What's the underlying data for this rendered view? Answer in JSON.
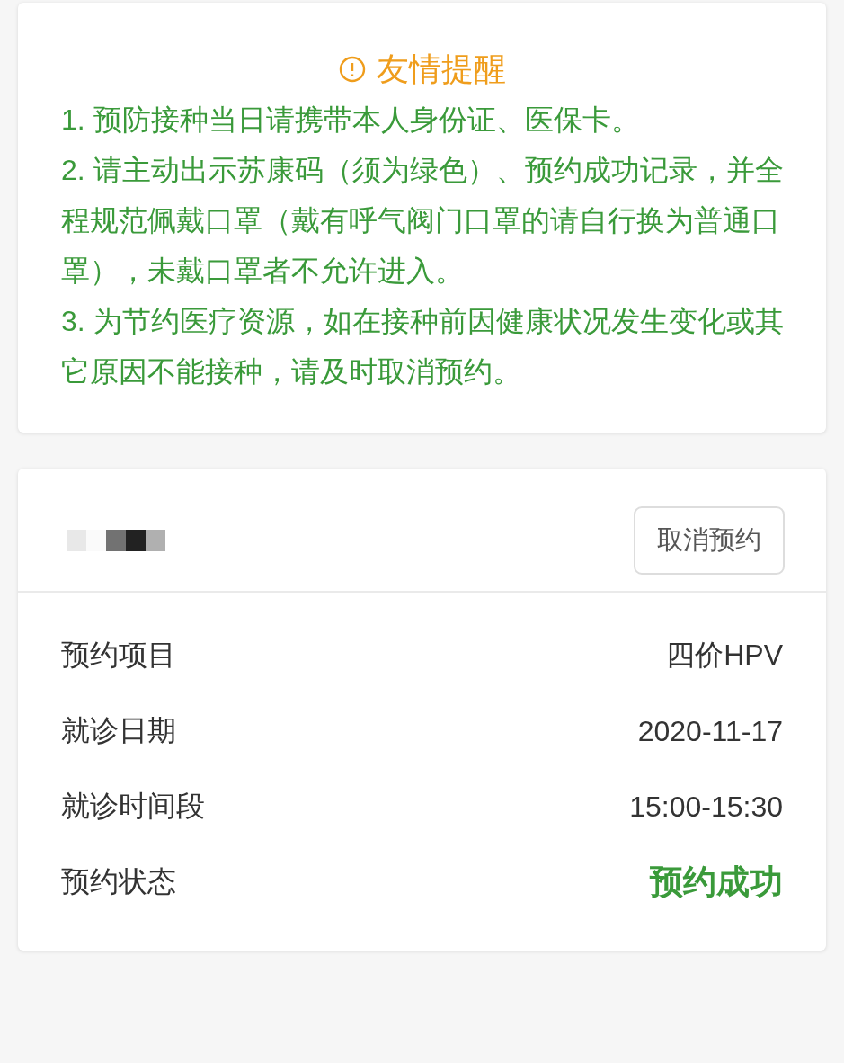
{
  "notice": {
    "title": "友情提醒",
    "items": [
      "1. 预防接种当日请携带本人身份证、医保卡。",
      "2. 请主动出示苏康码（须为绿色）、预约成功记录，并全程规范佩戴口罩（戴有呼气阀门口罩的请自行换为普通口罩），未戴口罩者不允许进入。",
      "3. 为节约医疗资源，如在接种前因健康状况发生变化或其它原因不能接种，请及时取消预约。"
    ]
  },
  "appointment": {
    "cancel_button": "取消预约",
    "details": [
      {
        "label": "预约项目",
        "value": "四价HPV",
        "kind": "plain"
      },
      {
        "label": "就诊日期",
        "value": "2020-11-17",
        "kind": "plain"
      },
      {
        "label": "就诊时间段",
        "value": "15:00-15:30",
        "kind": "plain"
      },
      {
        "label": "预约状态",
        "value": "预约成功",
        "kind": "status"
      }
    ]
  }
}
